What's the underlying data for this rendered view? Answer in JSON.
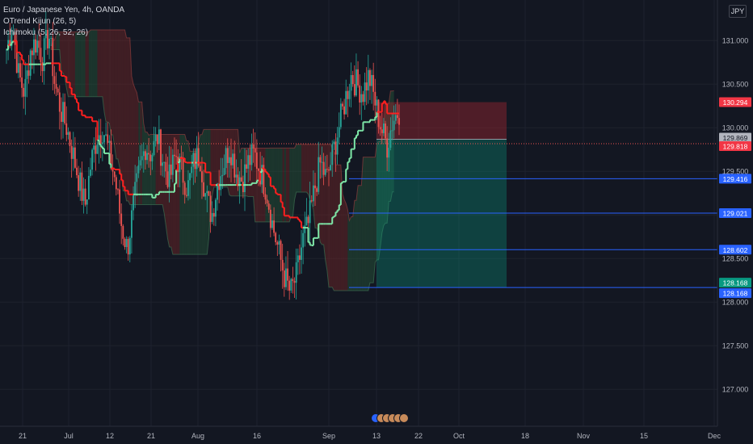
{
  "legend": {
    "title": "Euro / Japanese Yen, 4h, OANDA",
    "indicator1": "OTrend Kijun (26, 5)",
    "indicator2": "Ichimoku (5, 26, 52, 26)"
  },
  "currency_badge": "JPY",
  "colors": {
    "background": "#131722",
    "grid": "#1e222d",
    "axis_text": "#b2b5be",
    "candle_up": "#26a69a",
    "candle_down": "#ef5350",
    "kijun_up": "#7ee8a8",
    "kijun_down": "#ff1f1f",
    "target_line": "#2962ff",
    "stop_zone": "rgba(178,40,51,0.38)",
    "target_zone": "rgba(8,153,129,0.33)"
  },
  "chart_data": {
    "type": "candlestick",
    "symbol": "EURJPY",
    "ylim": [
      126.6,
      131.4
    ],
    "y_ticks": [
      "131.000",
      "130.500",
      "130.000",
      "129.500",
      "129.000",
      "128.500",
      "128.000",
      "127.500",
      "127.000"
    ],
    "x_ticks": [
      "21",
      "Jul",
      "12",
      "21",
      "Aug",
      "16",
      "Sep",
      "13",
      "22",
      "Oct",
      "18",
      "Nov",
      "15",
      "Dec"
    ],
    "price_path": [
      130.9,
      131.2,
      130.6,
      130.4,
      130.9,
      131.0,
      130.8,
      131.1,
      130.5,
      130.2,
      130.0,
      129.7,
      129.4,
      129.1,
      129.6,
      129.9,
      130.0,
      129.7,
      129.4,
      128.9,
      128.6,
      129.1,
      129.5,
      129.8,
      129.7,
      129.9,
      129.6,
      129.4,
      129.7,
      129.5,
      129.3,
      129.6,
      129.7,
      129.2,
      129.0,
      129.4,
      129.6,
      129.8,
      129.5,
      129.4,
      129.6,
      129.7,
      129.5,
      129.3,
      128.9,
      128.6,
      128.3,
      128.1,
      128.3,
      128.7,
      128.9,
      129.3,
      129.6,
      129.4,
      129.7,
      130.0,
      130.3,
      130.6,
      130.5,
      130.4,
      130.6,
      130.3,
      130.0,
      129.8,
      130.1,
      130.2
    ],
    "current_price": "129.818",
    "price_labels": {
      "stop": "130.294",
      "entry": "129.869",
      "current": "129.818"
    },
    "target_levels": [
      "129.416",
      "129.021",
      "128.602",
      "128.168"
    ],
    "target_zone_label": "128.168",
    "annotations": [
      "130.294",
      "129.869",
      "129.818",
      "129.416",
      "129.021",
      "128.602",
      "128.168",
      "128.168"
    ]
  }
}
